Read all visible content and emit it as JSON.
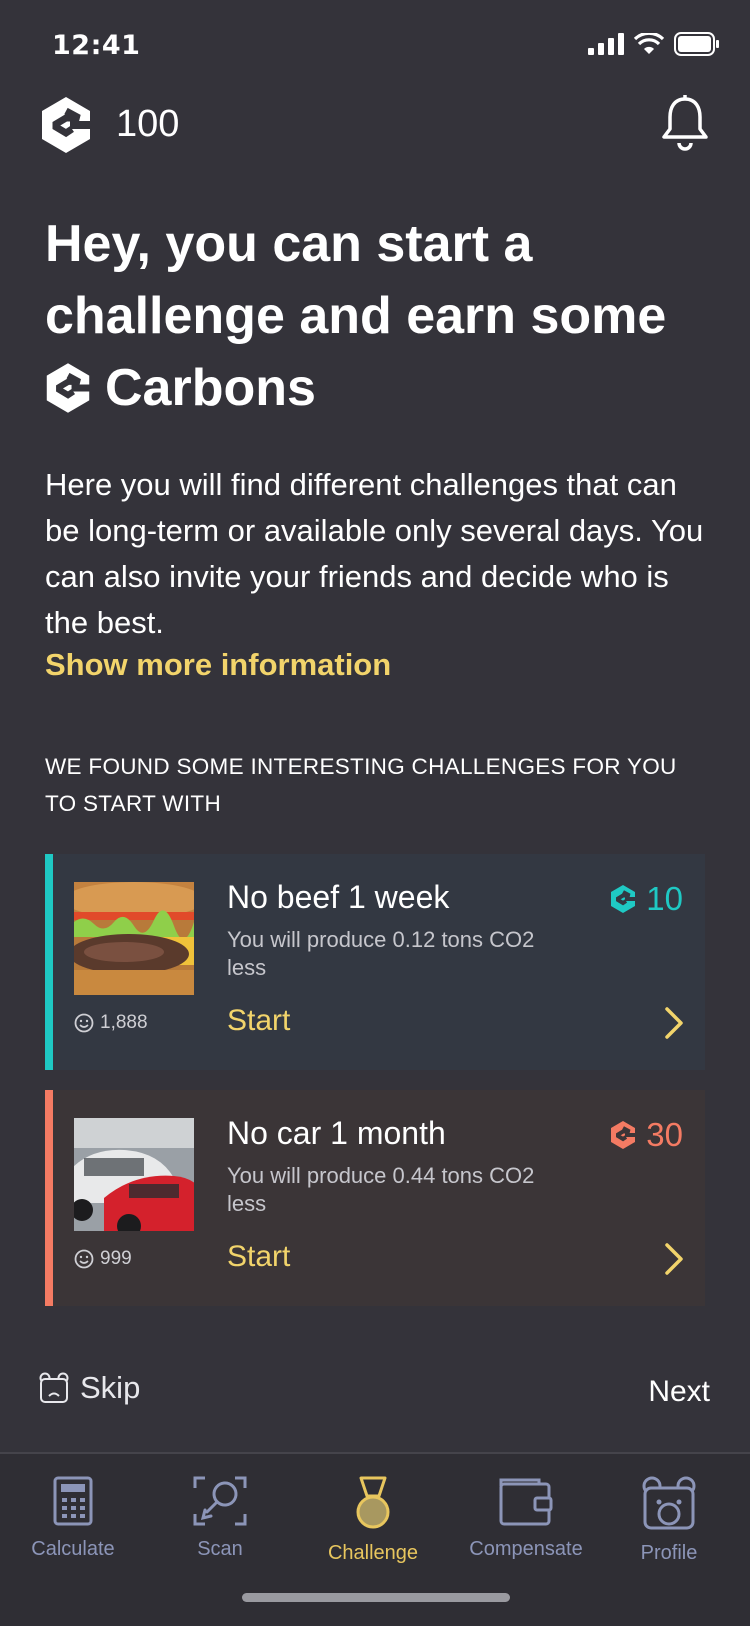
{
  "status_bar": {
    "time": "12:41"
  },
  "header": {
    "balance": "100"
  },
  "heading": {
    "line1": "Hey, you can start a",
    "line2": "challenge and earn some",
    "line3": "Carbons"
  },
  "intro": {
    "text": "Here you will find different challenges that can be long-term or available only several days. You can also invite your friends and decide who is the best.",
    "more_link": "Show more information"
  },
  "section_title": "WE FOUND SOME INTERESTING CHALLENGES FOR YOU TO START WITH",
  "challenges": [
    {
      "title": "No beef 1 week",
      "desc": "You will produce 0.12 tons CO2 less",
      "participants": "1,888",
      "reward": "10",
      "start": "Start",
      "accent": "#1fc9c4",
      "bg": "#333842"
    },
    {
      "title": "No car 1 month",
      "desc": "You will produce 0.44 tons CO2 less",
      "participants": "999",
      "reward": "30",
      "start": "Start",
      "accent": "#f47b63",
      "bg": "#3b3537"
    }
  ],
  "footer": {
    "skip": "Skip",
    "next": "Next"
  },
  "tabs": [
    {
      "label": "Calculate",
      "icon": "calculator-icon"
    },
    {
      "label": "Scan",
      "icon": "scan-icon"
    },
    {
      "label": "Challenge",
      "icon": "medal-icon"
    },
    {
      "label": "Compensate",
      "icon": "wallet-icon"
    },
    {
      "label": "Profile",
      "icon": "bear-icon"
    }
  ],
  "colors": {
    "background": "#34333a",
    "accent_yellow": "#f2d46b",
    "tab_inactive": "#8c95b8",
    "tab_active": "#e8c65e"
  }
}
